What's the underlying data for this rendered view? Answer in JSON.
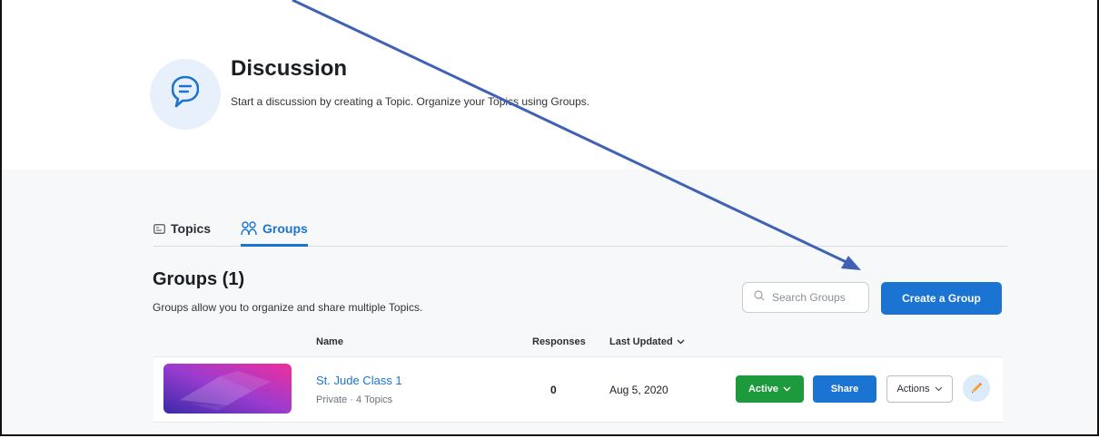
{
  "header": {
    "title": "Discussion",
    "subtitle": "Start a discussion by creating a Topic. Organize your Topics using Groups."
  },
  "tabs": [
    {
      "label": "Topics",
      "icon": "topics-icon",
      "active": false
    },
    {
      "label": "Groups",
      "icon": "groups-icon",
      "active": true
    }
  ],
  "section": {
    "heading": "Groups (1)",
    "description": "Groups allow you to organize and share multiple Topics."
  },
  "search": {
    "placeholder": "Search Groups"
  },
  "create_button": "Create a Group",
  "columns": {
    "name": "Name",
    "responses": "Responses",
    "last_updated": "Last Updated"
  },
  "groups": [
    {
      "name": "St. Jude Class 1",
      "meta": "Private · 4 Topics",
      "responses": "0",
      "last_updated": "Aug 5, 2020",
      "status": "Active",
      "share_label": "Share",
      "actions_label": "Actions"
    }
  ],
  "colors": {
    "accent_blue": "#1b74d1",
    "active_green": "#1d9a3b",
    "annotation_arrow": "#3f62b5"
  }
}
